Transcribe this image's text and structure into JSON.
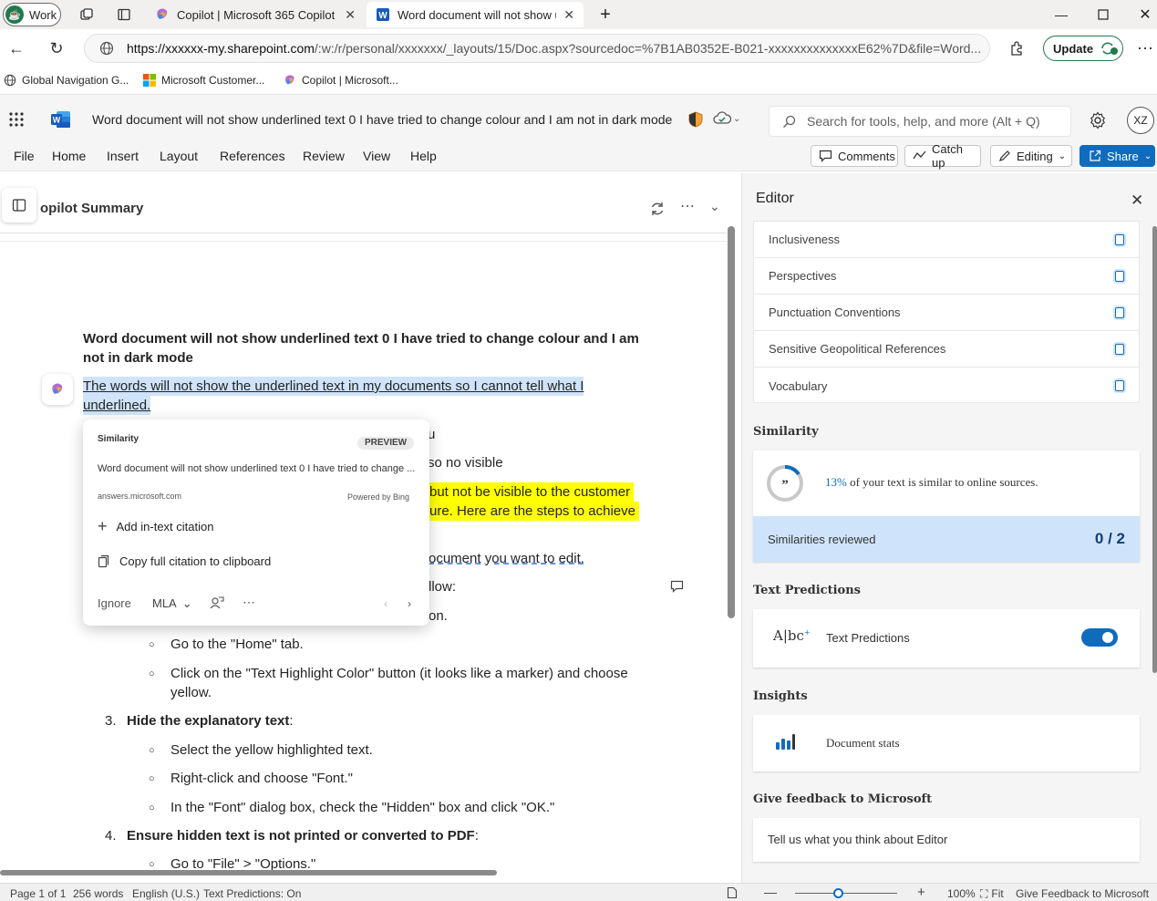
{
  "browser": {
    "profile_label": "Work",
    "tabs": [
      {
        "label": "Copilot | Microsoft 365 Copilot"
      },
      {
        "label": "Word document will not show un"
      }
    ],
    "url_host": "https://xxxxxx-my.sharepoint.com",
    "url_path": "/:w:/r/personal/xxxxxxx/_layouts/15/Doc.aspx?sourcedoc=%7B1AB0352E-B021-xxxxxxxxxxxxxxE62%7D&file=Word...",
    "update_label": "Update",
    "bookmarks": [
      "Global Navigation G...",
      "Microsoft Customer...",
      "Copilot | Microsoft..."
    ]
  },
  "word": {
    "title": "Word document will not show underlined text 0 I have tried to change colour and I am not in dark mode",
    "search_placeholder": "Search for tools, help, and more (Alt + Q)",
    "avatar_initials": "XZ",
    "menu": [
      "File",
      "Home",
      "Insert",
      "Layout",
      "References",
      "Review",
      "View",
      "Help"
    ],
    "buttons": {
      "comments": "Comments",
      "catch_up": "Catch up",
      "editing": "Editing",
      "share": "Share"
    }
  },
  "document": {
    "copilot_summary": "opilot Summary",
    "heading_line1": "Word document will not show underlined text 0 I have tried to change colour and I am",
    "heading_line2": "not in dark mode",
    "underlined_line1": "The words will not show the underlined text in my documents so I cannot tell what I",
    "underlined_line2": "underlined.",
    "partial_u": "u",
    "partial_no_visible": "so no visible",
    "hl_line1": "but not be visible to the customer",
    "hl_line2": "ure. Here are the steps to achieve",
    "partial_edit": "ocument you want to edit.",
    "partial_llow": "llow:",
    "partial_on": "on.",
    "step_home_tab": "Go to the \"Home\" tab.",
    "step_highlight_1": "Click on the \"Text Highlight Color\" button (it looks like a marker) and choose",
    "step_highlight_2": "yellow.",
    "step3_num": "3.",
    "step3_title": "Hide the explanatory text",
    "step3_a": "Select the yellow highlighted text.",
    "step3_b": "Right-click and choose \"Font.\"",
    "step3_c": "In the \"Font\" dialog box, check the \"Hidden\" box and click \"OK.\"",
    "step4_num": "4.",
    "step4_title": "Ensure hidden text is not printed or converted to PDF",
    "step4_a": "Go to \"File\" > \"Options.\""
  },
  "similarity_popup": {
    "title": "Similarity",
    "badge": "PREVIEW",
    "source_title": "Word document will not show underlined text 0 I have tried to change ...",
    "source_domain": "answers.microsoft.com",
    "powered": "Powered by Bing",
    "add_citation": "Add in-text citation",
    "copy_citation": "Copy full citation to clipboard",
    "ignore": "Ignore",
    "style": "MLA"
  },
  "editor": {
    "title": "Editor",
    "refinements": [
      "Inclusiveness",
      "Perspectives",
      "Punctuation Conventions",
      "Sensitive Geopolitical References",
      "Vocabulary"
    ],
    "similarity_heading": "Similarity",
    "similarity_percent": "13%",
    "similarity_text": "of your text is similar to online sources.",
    "similarities_reviewed_label": "Similarities reviewed",
    "similarities_reviewed_value": "0 / 2",
    "text_predictions_heading": "Text Predictions",
    "text_predictions_label": "Text Predictions",
    "text_predictions_on": true,
    "insights_heading": "Insights",
    "document_stats": "Document stats",
    "feedback_heading": "Give feedback to Microsoft",
    "feedback_text": "Tell us what you think about Editor"
  },
  "status": {
    "page": "Page 1 of 1",
    "words": "256 words",
    "language": "English (U.S.)",
    "predictions": "Text Predictions: On",
    "zoom": "100%",
    "fit": "Fit",
    "feedback": "Give Feedback to Microsoft",
    "zoom_level": 0.5
  },
  "colors": {
    "accent": "#0f6cbd",
    "highlight": "#ffff00",
    "selection": "#cfe4fa"
  }
}
